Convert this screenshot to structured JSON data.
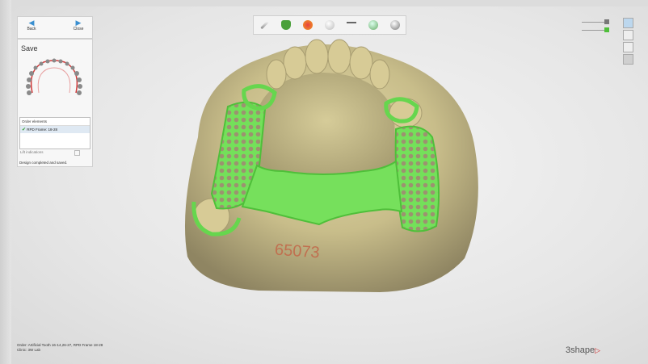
{
  "nav": {
    "back_label": "Back",
    "close_label": "Close"
  },
  "panel": {
    "title": "Save",
    "order_header": "Order elements",
    "order_item": "RPD Frame: 18-28",
    "lift_label": "Lift indications",
    "status_text": "Design completed and saved."
  },
  "model": {
    "engraving": "65073"
  },
  "footer": {
    "order_line": "Order:  Artificial Tooth 16-14,26-27, RPD Frame 18-28",
    "clinic_line": "Clinic:  3W Lab"
  },
  "brand": {
    "name": "3shape"
  },
  "colors": {
    "framework_green": "#6fdc57",
    "stone": "#c9bf8e",
    "accent_blue": "#3a8fd0",
    "logo_red": "#d03030"
  },
  "toolbar_icons": [
    "brush-icon",
    "pick-icon",
    "paint-icon",
    "sphere-icon",
    "clasp-icon",
    "globe-icon",
    "sphere-alt-icon"
  ]
}
